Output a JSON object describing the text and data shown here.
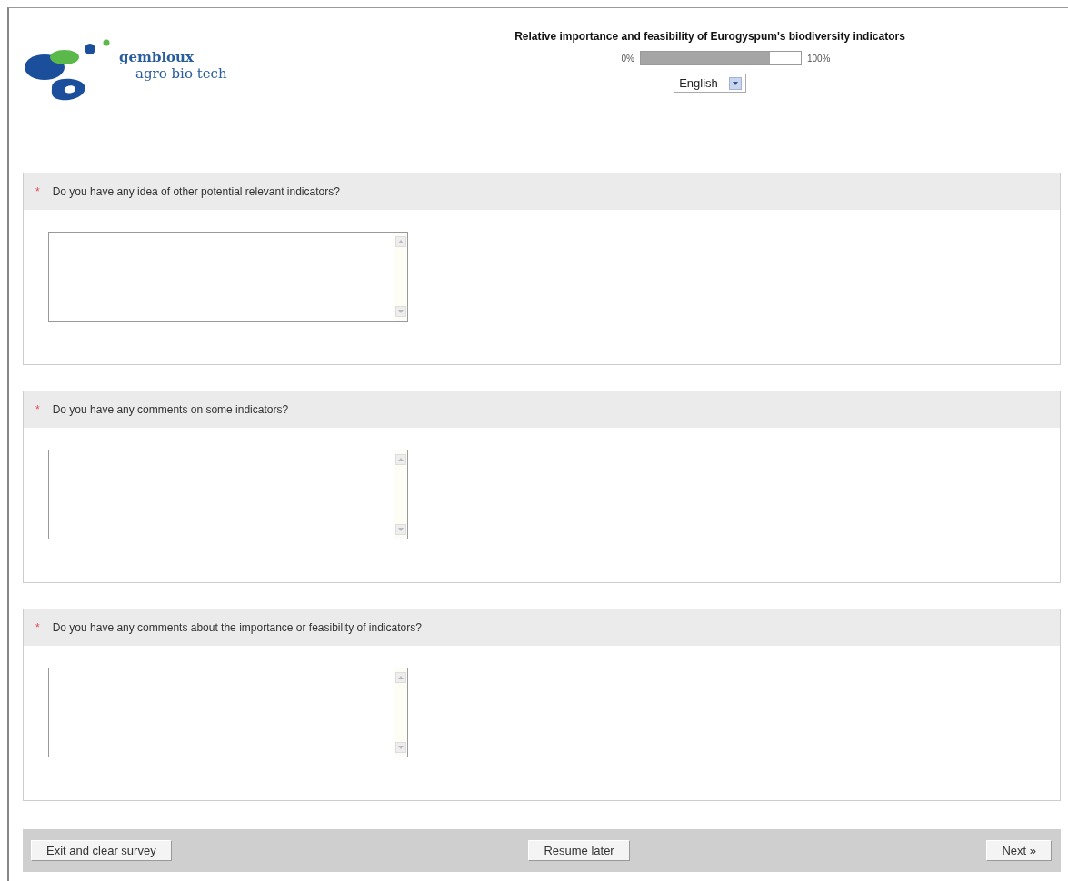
{
  "header": {
    "logo": {
      "line1": "gembloux",
      "line2": "agro bio tech"
    },
    "title": "Relative importance and feasibility of Eurogyspum's biodiversity indicators",
    "progress": {
      "min_label": "0%",
      "max_label": "100%",
      "level": 0.81
    },
    "language": {
      "value": "English"
    }
  },
  "questions": [
    {
      "mandatory_mark": "*",
      "text": "Do you have any idea of other potential relevant indicators?"
    },
    {
      "mandatory_mark": "*",
      "text": "Do you have any comments on some indicators?"
    },
    {
      "mandatory_mark": "*",
      "text": "Do you have any comments about the importance or feasibility of indicators?"
    }
  ],
  "footer": {
    "buttons": [
      {
        "label": "Exit and clear survey"
      },
      {
        "label": "Resume later"
      },
      {
        "label": "Next »"
      }
    ]
  }
}
